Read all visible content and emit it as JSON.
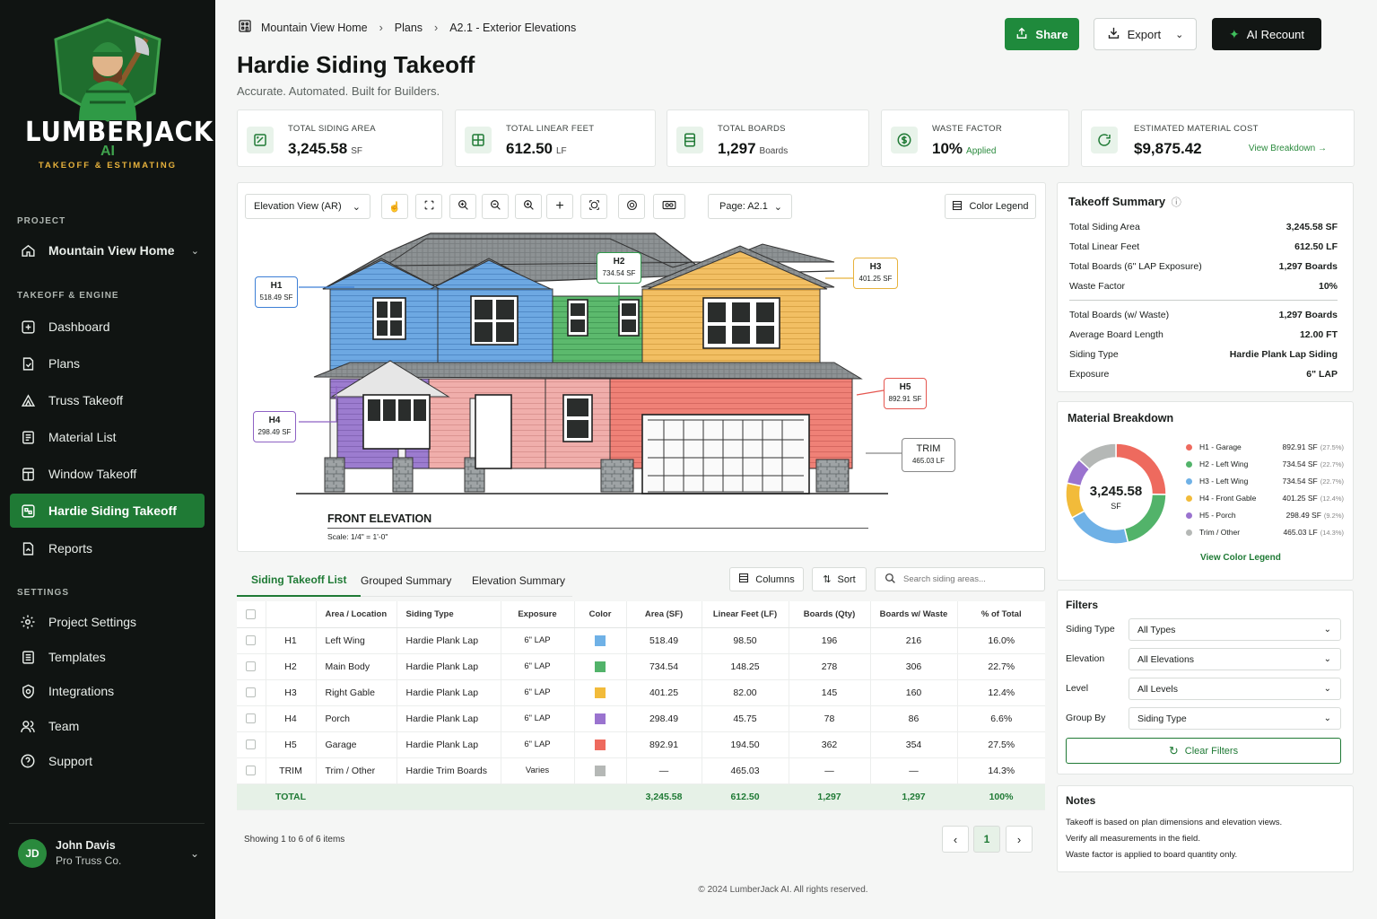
{
  "brand": {
    "name": "LUMBERJACK",
    "ai": "AI",
    "tagline": "TAKEOFF & ESTIMATING"
  },
  "sidebar": {
    "project_label": "PROJECT",
    "project_name": "Mountain View Home",
    "engine_label": "TAKEOFF & ENGINE",
    "items": [
      {
        "label": "Dashboard",
        "icon": "dashboard-icon"
      },
      {
        "label": "Plans",
        "icon": "plans-icon"
      },
      {
        "label": "Truss Takeoff",
        "icon": "truss-icon"
      },
      {
        "label": "Material List",
        "icon": "list-icon"
      },
      {
        "label": "Window Takeoff",
        "icon": "window-icon"
      },
      {
        "label": "Hardie Siding Takeoff",
        "icon": "siding-icon",
        "active": true
      },
      {
        "label": "Reports",
        "icon": "reports-icon"
      }
    ],
    "settings_label": "SETTINGS",
    "settings": [
      {
        "label": "Project Settings",
        "icon": "gear-icon"
      },
      {
        "label": "Templates",
        "icon": "templates-icon"
      },
      {
        "label": "Integrations",
        "icon": "integrations-icon"
      },
      {
        "label": "Team",
        "icon": "team-icon"
      },
      {
        "label": "Support",
        "icon": "help-icon"
      }
    ],
    "user": {
      "initials": "JD",
      "name": "John Davis",
      "company": "Pro Truss Co."
    }
  },
  "breadcrumb": [
    "Mountain View Home",
    "Plans",
    "A2.1 - Exterior Elevations"
  ],
  "header": {
    "title": "Hardie Siding Takeoff",
    "subtitle": "Accurate. Automated. Built for Builders."
  },
  "actions": {
    "share": "Share",
    "export": "Export",
    "recount": "AI Recount"
  },
  "kpis": [
    {
      "label": "TOTAL SIDING AREA",
      "value": "3,245.58",
      "unit": "SF"
    },
    {
      "label": "TOTAL LINEAR FEET",
      "value": "612.50",
      "unit": "LF"
    },
    {
      "label": "TOTAL BOARDS",
      "value": "1,297",
      "unit": "Boards"
    },
    {
      "label": "WASTE FACTOR",
      "value": "10%",
      "unit": "Applied"
    },
    {
      "label": "ESTIMATED MATERIAL COST",
      "value": "$9,875.42",
      "link": "View Breakdown"
    }
  ],
  "viewer": {
    "view_select": "Elevation View (AR)",
    "page_select": "Page: A2.1",
    "legend_btn": "Color Legend",
    "drawing_title": "FRONT ELEVATION",
    "scale": "Scale: 1/4\" = 1'-0\"",
    "callouts": [
      {
        "id": "H1",
        "value": "518.49 SF",
        "color": "#3d7fd6"
      },
      {
        "id": "H2",
        "value": "734.54 SF",
        "color": "#2e9a4a"
      },
      {
        "id": "H3",
        "value": "401.25 SF",
        "color": "#e7b23c"
      },
      {
        "id": "H4",
        "value": "298.49 SF",
        "color": "#8e62c4"
      },
      {
        "id": "H5",
        "value": "892.91 SF",
        "color": "#e5564f"
      },
      {
        "id": "TRIM",
        "value": "465.03 LF",
        "color": "#888888"
      }
    ]
  },
  "tabs": [
    "Siding Takeoff List",
    "Grouped Summary",
    "Elevation Summary"
  ],
  "table_tools": {
    "columns": "Columns",
    "sort": "Sort",
    "search_placeholder": "Search siding areas..."
  },
  "table": {
    "headers": [
      "Area / Location",
      "Siding Type",
      "Exposure",
      "Color",
      "Area (SF)",
      "Linear Feet (LF)",
      "Boards (Qty)",
      "Boards w/ Waste",
      "% of Total"
    ],
    "rows": [
      {
        "id": "H1",
        "loc": "Left Wing",
        "type": "Hardie Plank Lap",
        "exp": "6\" LAP",
        "color": "#6fb1e6",
        "area": "518.49",
        "lf": "98.50",
        "boards": "196",
        "waste": "216",
        "pct": "16.0%"
      },
      {
        "id": "H2",
        "loc": "Main Body",
        "type": "Hardie Plank Lap",
        "exp": "6\" LAP",
        "color": "#52b36a",
        "area": "734.54",
        "lf": "148.25",
        "boards": "278",
        "waste": "306",
        "pct": "22.7%"
      },
      {
        "id": "H3",
        "loc": "Right Gable",
        "type": "Hardie Plank Lap",
        "exp": "6\" LAP",
        "color": "#f2bb3a",
        "area": "401.25",
        "lf": "82.00",
        "boards": "145",
        "waste": "160",
        "pct": "12.4%"
      },
      {
        "id": "H4",
        "loc": "Porch",
        "type": "Hardie Plank Lap",
        "exp": "6\" LAP",
        "color": "#9a73cf",
        "area": "298.49",
        "lf": "45.75",
        "boards": "78",
        "waste": "86",
        "pct": "6.6%"
      },
      {
        "id": "H5",
        "loc": "Garage",
        "type": "Hardie Plank Lap",
        "exp": "6\" LAP",
        "color": "#ee6a5e",
        "area": "892.91",
        "lf": "194.50",
        "boards": "362",
        "waste": "354",
        "pct": "27.5%"
      },
      {
        "id": "TRIM",
        "loc": "Trim / Other",
        "type": "Hardie Trim Boards",
        "exp": "Varies",
        "color": "#b5b8b6",
        "area": "—",
        "lf": "465.03",
        "boards": "—",
        "waste": "—",
        "pct": "14.3%"
      }
    ],
    "total": {
      "label": "TOTAL",
      "area": "3,245.58",
      "lf": "612.50",
      "boards": "1,297",
      "waste": "1,297",
      "pct": "100%"
    },
    "showing": "Showing 1 to 6 of 6 items",
    "page": "1"
  },
  "summary": {
    "title": "Takeoff Summary",
    "rows_a": [
      {
        "k": "Total Siding Area",
        "v": "3,245.58 SF"
      },
      {
        "k": "Total Linear Feet",
        "v": "612.50 LF"
      },
      {
        "k": "Total Boards (6\" LAP Exposure)",
        "v": "1,297 Boards"
      },
      {
        "k": "Waste Factor",
        "v": "10%"
      }
    ],
    "rows_b": [
      {
        "k": "Total Boards (w/ Waste)",
        "v": "1,297 Boards"
      },
      {
        "k": "Average Board Length",
        "v": "12.00 FT"
      },
      {
        "k": "Siding Type",
        "v": "Hardie Plank Lap Siding"
      },
      {
        "k": "Exposure",
        "v": "6\" LAP"
      }
    ]
  },
  "breakdown": {
    "title": "Material Breakdown",
    "center_value": "3,245.58",
    "center_unit": "SF",
    "link": "View Color Legend",
    "items": [
      {
        "name": "H1 - Garage",
        "value": "892.91 SF",
        "pct": "(27.5%)",
        "share": 27.5,
        "color": "#ee6a5e"
      },
      {
        "name": "H2 - Left Wing",
        "value": "734.54 SF",
        "pct": "(22.7%)",
        "share": 22.7,
        "color": "#52b36a"
      },
      {
        "name": "H3 - Left Wing",
        "value": "734.54 SF",
        "pct": "(22.7%)",
        "share": 22.7,
        "color": "#6fb1e6"
      },
      {
        "name": "H4 - Front Gable",
        "value": "401.25 SF",
        "pct": "(12.4%)",
        "share": 12.4,
        "color": "#f2bb3a"
      },
      {
        "name": "H5 - Porch",
        "value": "298.49 SF",
        "pct": "(9.2%)",
        "share": 9.2,
        "color": "#9a73cf"
      },
      {
        "name": "Trim / Other",
        "value": "465.03 LF",
        "pct": "(14.3%)",
        "share": 14.3,
        "color": "#b5b8b6"
      }
    ]
  },
  "filters": {
    "title": "Filters",
    "rows": [
      {
        "label": "Siding Type",
        "value": "All Types"
      },
      {
        "label": "Elevation",
        "value": "All Elevations"
      },
      {
        "label": "Level",
        "value": "All Levels"
      },
      {
        "label": "Group By",
        "value": "Siding Type"
      }
    ],
    "clear": "Clear Filters"
  },
  "notes": {
    "title": "Notes",
    "lines": [
      "Takeoff is based on plan dimensions and elevation views.",
      "Verify all measurements in the field.",
      "Waste factor is applied to board quantity only."
    ]
  },
  "footer": "© 2024 LumberJack AI. All rights reserved."
}
